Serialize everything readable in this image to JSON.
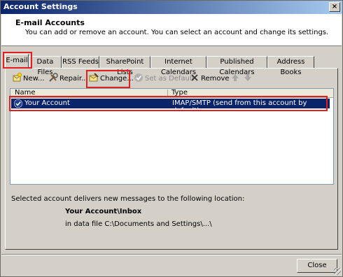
{
  "window": {
    "title": "Account Settings",
    "close_glyph": "×"
  },
  "header": {
    "title": "E-mail Accounts",
    "description": "You can add or remove an account. You can select an account and change its settings."
  },
  "tabs": [
    {
      "label": "E-mail",
      "active": true
    },
    {
      "label": "Data Files"
    },
    {
      "label": "RSS Feeds"
    },
    {
      "label": "SharePoint Lists"
    },
    {
      "label": "Internet Calendars"
    },
    {
      "label": "Published Calendars"
    },
    {
      "label": "Address Books"
    }
  ],
  "toolbar": {
    "new": {
      "label": "New...",
      "icon": "new-icon"
    },
    "repair": {
      "label": "Repair...",
      "icon": "repair-icon"
    },
    "change": {
      "label": "Change...",
      "icon": "change-icon"
    },
    "set_default": {
      "label": "Set as Default",
      "icon": "check-circle-icon",
      "disabled": true
    },
    "remove": {
      "label": "Remove",
      "icon": "x-icon"
    },
    "move_up": {
      "icon": "arrow-up-icon",
      "disabled": true
    },
    "move_down": {
      "icon": "arrow-down-icon",
      "disabled": true
    }
  },
  "accounts": {
    "columns": [
      "Name",
      "Type"
    ],
    "rows": [
      {
        "name": "Your Account",
        "type": "IMAP/SMTP (send from this account by default)",
        "default": true,
        "selected": true
      }
    ]
  },
  "delivery": {
    "intro": "Selected account delivers new messages to the following location:",
    "folder": "Your Account\\Inbox",
    "data_file": "in data file C:\\Documents and Settings\\...\\"
  },
  "footer": {
    "close_label": "Close"
  },
  "colors": {
    "titlebar": "#0a246a",
    "selection": "#0a246a",
    "highlight_box": "#e02020",
    "dialog_bg": "#d4d0c8"
  }
}
